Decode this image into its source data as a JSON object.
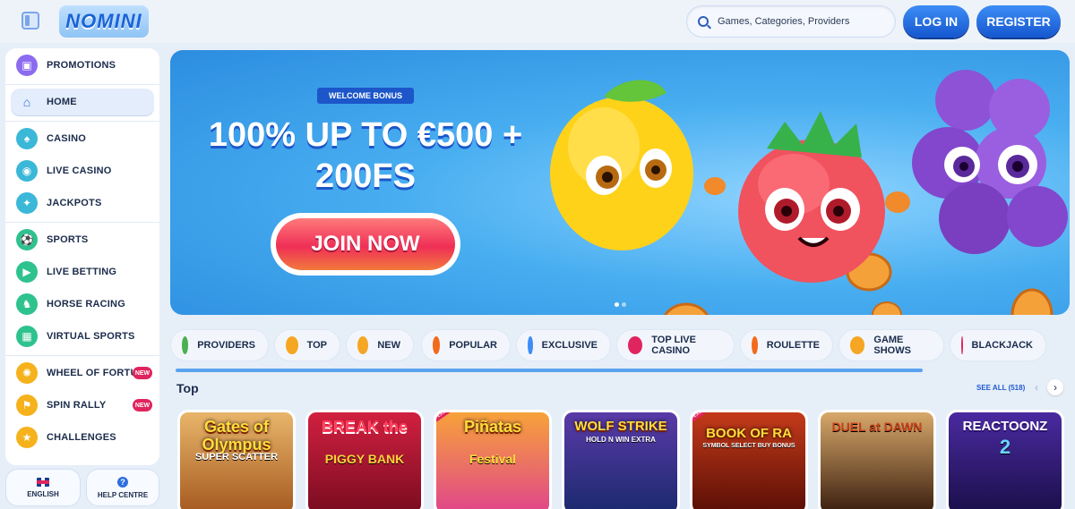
{
  "header": {
    "logo": "NOMINI",
    "search_placeholder": "Games, Categories, Providers",
    "login": "LOG IN",
    "register": "REGISTER"
  },
  "sidebar": {
    "items": [
      {
        "label": "PROMOTIONS",
        "icon": "gift-icon",
        "color": "#8b6cf0"
      },
      {
        "label": "HOME",
        "icon": "home-icon",
        "color": "#2d6fe0"
      },
      {
        "label": "CASINO",
        "icon": "spade-icon",
        "color": "#3bb8d8"
      },
      {
        "label": "LIVE CASINO",
        "icon": "chip-icon",
        "color": "#3bb8d8"
      },
      {
        "label": "JACKPOTS",
        "icon": "jackpot-icon",
        "color": "#3bb8d8"
      },
      {
        "label": "SPORTS",
        "icon": "football-icon",
        "color": "#2ec28e"
      },
      {
        "label": "LIVE BETTING",
        "icon": "live-icon",
        "color": "#2ec28e"
      },
      {
        "label": "HORSE RACING",
        "icon": "horse-icon",
        "color": "#2ec28e"
      },
      {
        "label": "VIRTUAL SPORTS",
        "icon": "virtual-icon",
        "color": "#2ec28e"
      },
      {
        "label": "WHEEL OF FORTUNE",
        "icon": "wheel-icon",
        "color": "#f5b21c",
        "badge": "NEW"
      },
      {
        "label": "SPIN RALLY",
        "icon": "rally-icon",
        "color": "#f5b21c",
        "badge": "NEW"
      },
      {
        "label": "CHALLENGES",
        "icon": "challenge-icon",
        "color": "#f5b21c"
      }
    ],
    "language": "ENGLISH",
    "help": "HELP CENTRE"
  },
  "banner": {
    "tag": "WELCOME BONUS",
    "title_line1": "100% UP TO €500 +",
    "title_line2": "200FS",
    "cta": "JOIN NOW"
  },
  "categories": [
    {
      "label": "PROVIDERS",
      "icon": "providers-icon",
      "color": "#4caf50"
    },
    {
      "label": "TOP",
      "icon": "crown-icon",
      "color": "#f5a623"
    },
    {
      "label": "NEW",
      "icon": "lightning-icon",
      "color": "#f5a623"
    },
    {
      "label": "POPULAR",
      "icon": "fire-icon",
      "color": "#f26b1d"
    },
    {
      "label": "EXCLUSIVE",
      "icon": "diamond-icon",
      "color": "#3d8df5"
    },
    {
      "label": "TOP LIVE CASINO",
      "icon": "dice-icon",
      "color": "#e0245e"
    },
    {
      "label": "ROULETTE",
      "icon": "roulette-icon",
      "color": "#f26b1d"
    },
    {
      "label": "GAME SHOWS",
      "icon": "gameshow-icon",
      "color": "#f5a623"
    },
    {
      "label": "BLACKJACK",
      "icon": "cards-icon",
      "color": "#e0245e"
    }
  ],
  "top": {
    "title": "Top",
    "see_all": "SEE ALL (518)",
    "games": [
      {
        "title": "Gates of Olympus",
        "sub": "SUPER SCATTER",
        "bg": "#c97a2a"
      },
      {
        "title": "BREAK the",
        "sub": "PIGGY BANK",
        "bg": "#b3123a"
      },
      {
        "title": "Piñatas",
        "sub": "Festival",
        "bg": "#f06fa8",
        "ribbon": "EXCLUSIVE"
      },
      {
        "title": "WOLF STRIKE",
        "sub": "HOLD N WIN EXTRA",
        "bg": "#2a3e9c"
      },
      {
        "title": "BOOK OF RA",
        "sub": "SYMBOL SELECT BUY BONUS",
        "bg": "#8a1f10",
        "ribbon": "EXCLUSIVE"
      },
      {
        "title": "DUEL at DAWN",
        "sub": "",
        "bg": "#6b3a1a"
      },
      {
        "title": "REACTOONZ",
        "sub": "2",
        "bg": "#3a1f7a"
      }
    ]
  }
}
